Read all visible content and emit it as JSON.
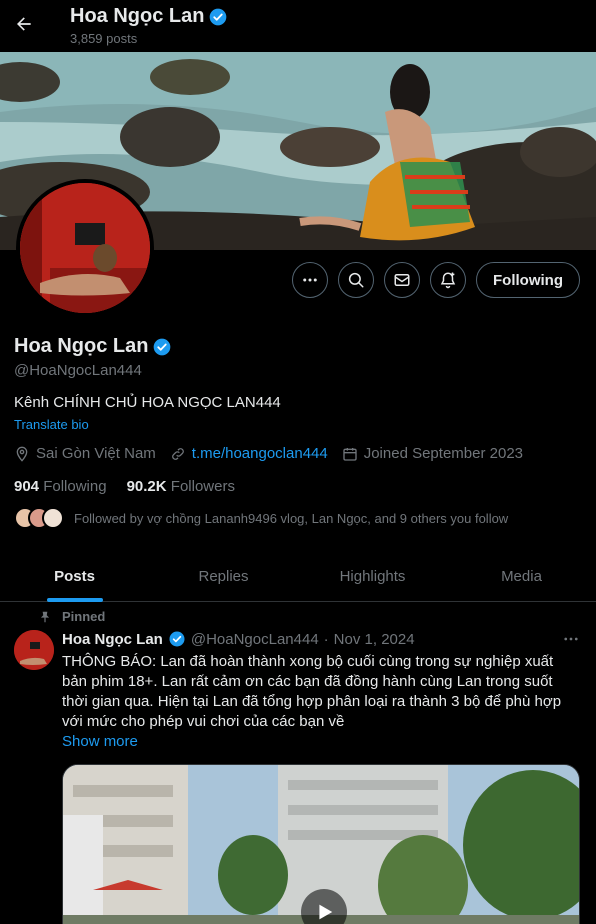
{
  "header": {
    "name": "Hoa Ngọc Lan",
    "post_count": "3,859 posts"
  },
  "profile": {
    "name": "Hoa Ngọc Lan",
    "handle": "@HoaNgocLan444",
    "bio": "Kênh CHÍNH CHỦ HOA NGỌC LAN444",
    "translate_label": "Translate bio",
    "location": "Sai Gòn Việt Nam",
    "link": "t.me/hoangoclan444",
    "joined": "Joined September 2023",
    "following_count": "904",
    "following_label": "Following",
    "followers_count": "90.2K",
    "followers_label": "Followers",
    "followed_by": "Followed by vợ chồng Lananh9496 vlog, Lan Ngọc, and 9 others you follow"
  },
  "actions": {
    "follow_label": "Following",
    "icons": [
      "more-icon",
      "search-icon",
      "message-icon",
      "notify-icon"
    ]
  },
  "tabs": [
    {
      "label": "Posts",
      "active": true
    },
    {
      "label": "Replies",
      "active": false
    },
    {
      "label": "Highlights",
      "active": false
    },
    {
      "label": "Media",
      "active": false
    }
  ],
  "pinned_post": {
    "pinned_label": "Pinned",
    "name": "Hoa Ngọc Lan",
    "handle": "@HoaNgocLan444",
    "separator": "·",
    "date": "Nov 1, 2024",
    "text": "THÔNG BÁO: Lan đã hoàn thành xong bộ cuối cùng trong sự nghiệp xuất bản phim 18+. Lan rất cảm ơn các bạn đã đồng hành cùng Lan trong suốt thời gian qua. Hiện tại Lan đã tổng hợp phân loại ra thành 3 bộ để phù hợp với mức cho phép vui chơi của các bạn về",
    "show_more": "Show more"
  },
  "colors": {
    "accent": "#1d9bf0",
    "background": "#000000",
    "text_primary": "#e7e9ea",
    "text_secondary": "#71767b",
    "border": "#536471"
  }
}
